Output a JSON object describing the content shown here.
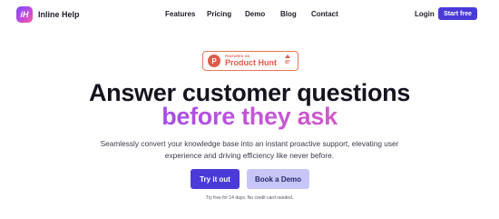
{
  "brand": {
    "logo_glyph": "iH",
    "name": "Inline Help"
  },
  "nav": {
    "links": [
      "Features",
      "Pricing",
      "Demo",
      "Blog",
      "Contact"
    ],
    "login": "Login",
    "start_free": "Start free"
  },
  "product_hunt": {
    "featured_on": "FEATURED ON",
    "name": "Product Hunt",
    "logo_glyph": "P",
    "votes": "87"
  },
  "hero": {
    "title_line1": "Answer customer questions",
    "title_line2": "before they ask",
    "description_line1": "Seamlessly convert your knowledge base into an instant proactive support, elevating user",
    "description_line2": "experience and driving efficiency like never before.",
    "try_button": "Try it out",
    "demo_button": "Book a Demo",
    "note": "Try free for 14 days. No credit card needed."
  },
  "colors": {
    "primary": "#4a3bd8",
    "secondary_button": "#c8c6f8",
    "product_hunt": "#e05a4a",
    "gradient_start": "#a44de8",
    "gradient_end": "#d05ac8"
  }
}
